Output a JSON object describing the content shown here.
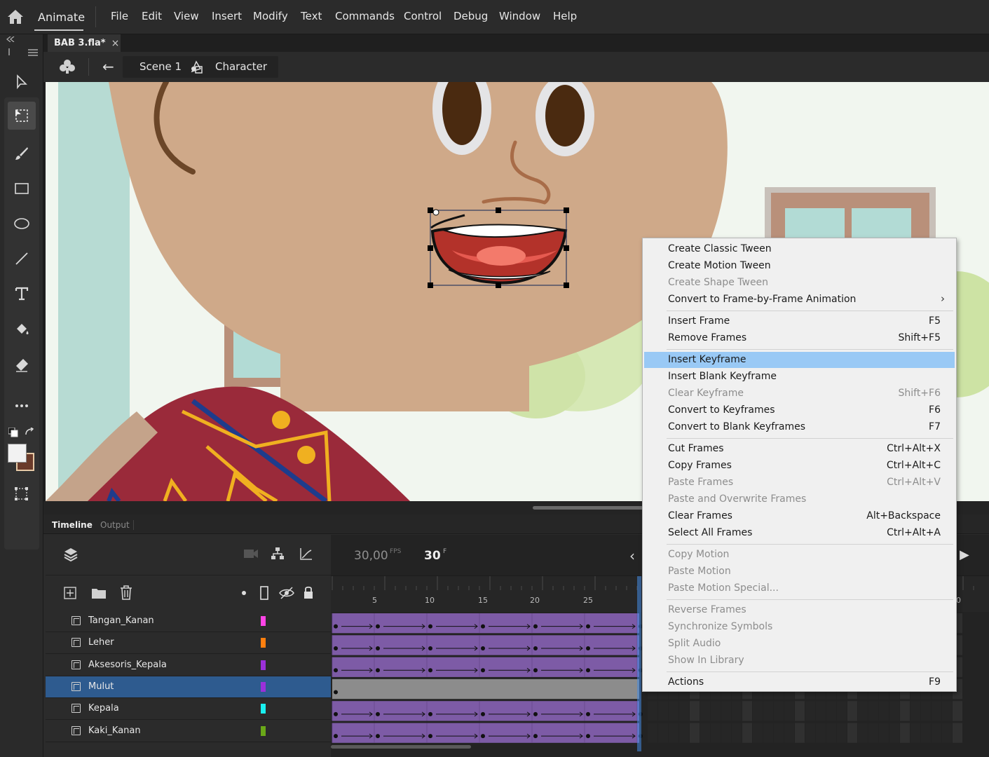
{
  "app": {
    "name": "Animate"
  },
  "menubar": [
    "File",
    "Edit",
    "View",
    "Insert",
    "Modify",
    "Text",
    "Commands",
    "Control",
    "Debug",
    "Window",
    "Help"
  ],
  "document_tab": {
    "label": "BAB 3.fla*",
    "close": "×"
  },
  "scene_bar": {
    "back": "←",
    "scene": "Scene 1",
    "symbol": "Character"
  },
  "timeline": {
    "tabs": [
      "Timeline",
      "Output"
    ],
    "fps": "30,00",
    "fps_unit": "FPS",
    "current_frame": "30",
    "frame_unit": "F",
    "ruler_numbers": [
      "5",
      "10",
      "15",
      "20",
      "25",
      "0"
    ],
    "layers": [
      {
        "name": "Tangan_Kanan",
        "color": "#ff44e6",
        "selected": false
      },
      {
        "name": "Leher",
        "color": "#ff7f0e",
        "selected": false
      },
      {
        "name": "Aksesoris_Kepala",
        "color": "#9b30d9",
        "selected": false
      },
      {
        "name": "Mulut",
        "color": "#9b30d9",
        "selected": true
      },
      {
        "name": "Kepala",
        "color": "#19f0f0",
        "selected": false
      },
      {
        "name": "Kaki_Kanan",
        "color": "#6aa818",
        "selected": false
      }
    ]
  },
  "context_menu": {
    "items": [
      {
        "label": "Create Classic Tween",
        "shortcut": "",
        "disabled": false
      },
      {
        "label": "Create Motion Tween",
        "shortcut": "",
        "disabled": false
      },
      {
        "label": "Create Shape Tween",
        "shortcut": "",
        "disabled": true
      },
      {
        "label": "Convert to Frame-by-Frame Animation",
        "shortcut": "",
        "disabled": false,
        "submenu": true
      },
      {
        "separator": true
      },
      {
        "label": "Insert Frame",
        "shortcut": "F5",
        "disabled": false
      },
      {
        "label": "Remove Frames",
        "shortcut": "Shift+F5",
        "disabled": false
      },
      {
        "separator": true
      },
      {
        "label": "Insert Keyframe",
        "shortcut": "",
        "disabled": false,
        "highlight": true
      },
      {
        "label": "Insert Blank Keyframe",
        "shortcut": "",
        "disabled": false
      },
      {
        "label": "Clear Keyframe",
        "shortcut": "Shift+F6",
        "disabled": true
      },
      {
        "label": "Convert to Keyframes",
        "shortcut": "F6",
        "disabled": false
      },
      {
        "label": "Convert to Blank Keyframes",
        "shortcut": "F7",
        "disabled": false
      },
      {
        "separator": true
      },
      {
        "label": "Cut Frames",
        "shortcut": "Ctrl+Alt+X",
        "disabled": false
      },
      {
        "label": "Copy Frames",
        "shortcut": "Ctrl+Alt+C",
        "disabled": false
      },
      {
        "label": "Paste Frames",
        "shortcut": "Ctrl+Alt+V",
        "disabled": true
      },
      {
        "label": "Paste and Overwrite Frames",
        "shortcut": "",
        "disabled": true
      },
      {
        "label": "Clear Frames",
        "shortcut": "Alt+Backspace",
        "disabled": false
      },
      {
        "label": "Select All Frames",
        "shortcut": "Ctrl+Alt+A",
        "disabled": false
      },
      {
        "separator": true
      },
      {
        "label": "Copy Motion",
        "shortcut": "",
        "disabled": true
      },
      {
        "label": "Paste Motion",
        "shortcut": "",
        "disabled": true
      },
      {
        "label": "Paste Motion Special...",
        "shortcut": "",
        "disabled": true
      },
      {
        "separator": true
      },
      {
        "label": "Reverse Frames",
        "shortcut": "",
        "disabled": true
      },
      {
        "label": "Synchronize Symbols",
        "shortcut": "",
        "disabled": true
      },
      {
        "label": "Split Audio",
        "shortcut": "",
        "disabled": true
      },
      {
        "label": "Show In Library",
        "shortcut": "",
        "disabled": true
      },
      {
        "separator": true
      },
      {
        "label": "Actions",
        "shortcut": "F9",
        "disabled": false
      }
    ]
  },
  "colors": {
    "frame_span": "#7d5ba6",
    "selected_layer": "#2e5b8f",
    "menu_highlight": "#99c9f5",
    "skin": "#cfa989",
    "shirt": "#9a2a3a"
  }
}
